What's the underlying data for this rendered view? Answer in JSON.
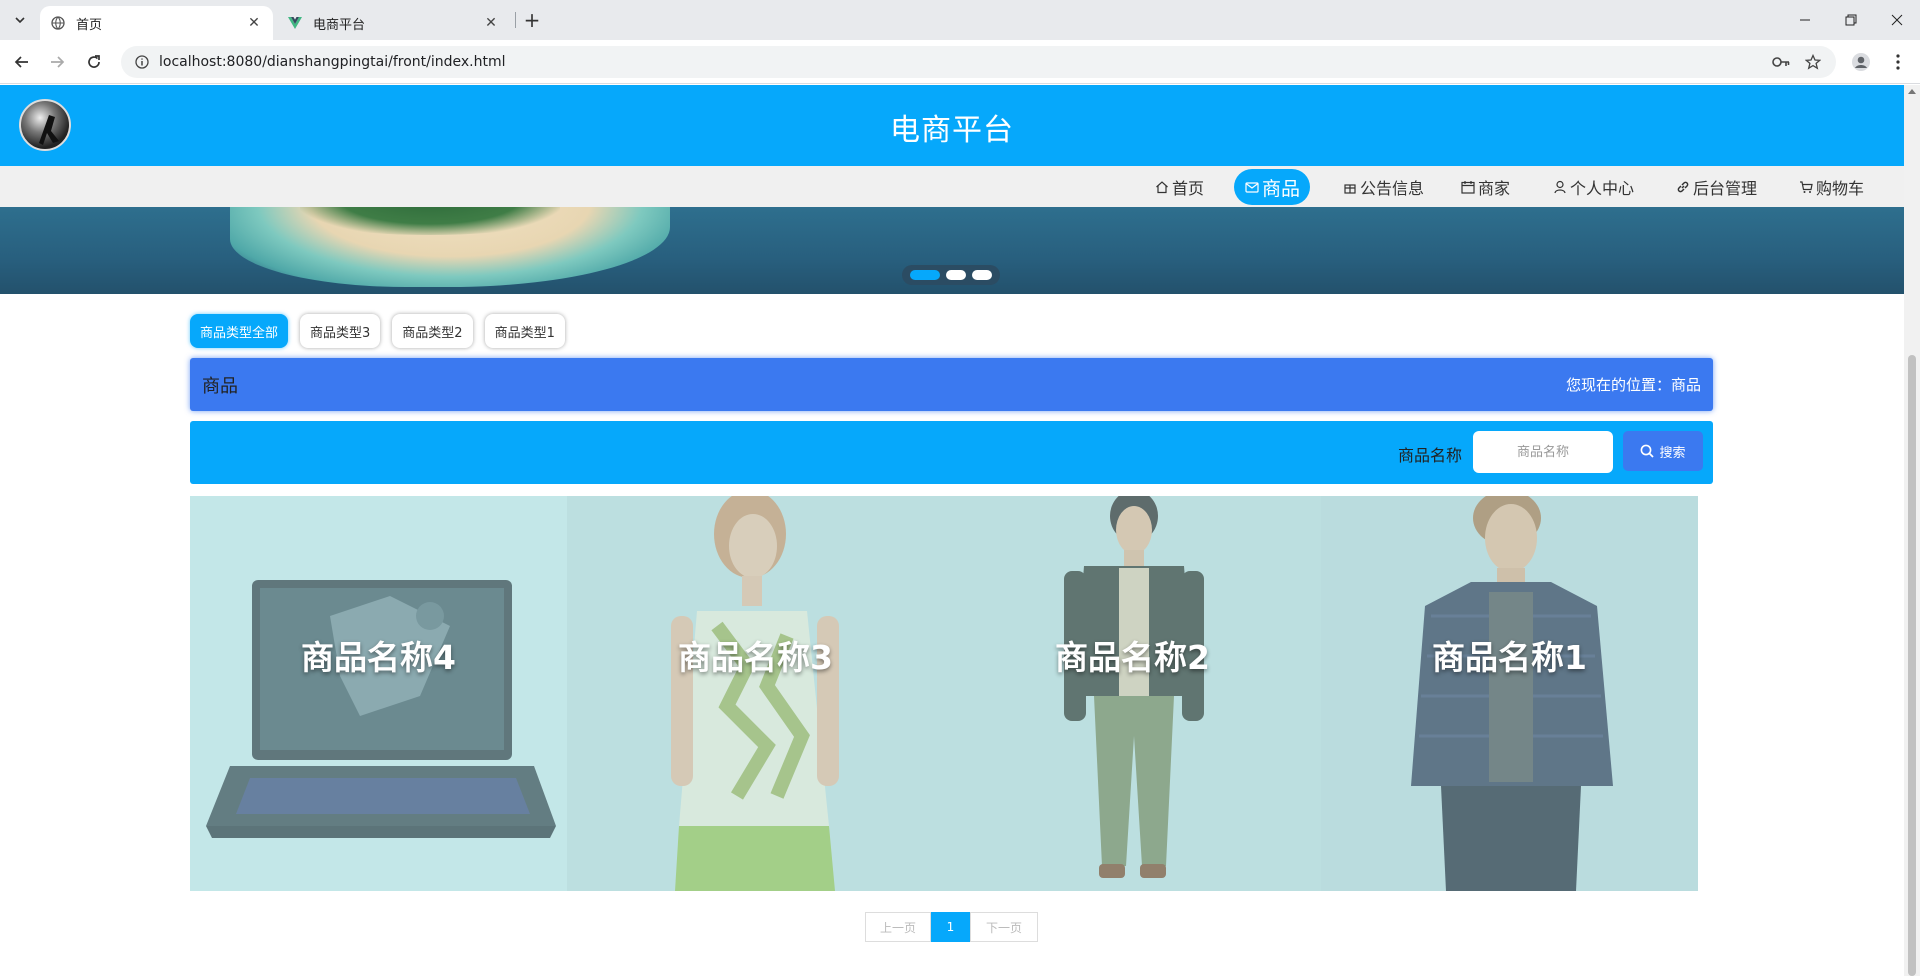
{
  "browser": {
    "tabs": [
      {
        "title": "首页",
        "active": true
      },
      {
        "title": "电商平台",
        "active": false
      }
    ],
    "url": "localhost:8080/dianshangpingtai/front/index.html"
  },
  "site": {
    "title": "电商平台",
    "nav": [
      {
        "label": "首页",
        "icon": "home-icon"
      },
      {
        "label": "商品",
        "icon": "mail-icon",
        "active": true
      },
      {
        "label": "公告信息",
        "icon": "gift-icon"
      },
      {
        "label": "商家",
        "icon": "calendar-icon"
      },
      {
        "label": "个人中心",
        "icon": "user-icon"
      },
      {
        "label": "后台管理",
        "icon": "link-icon"
      },
      {
        "label": "购物车",
        "icon": "cart-icon"
      }
    ]
  },
  "banner": {
    "slide_count": 3,
    "active_slide": 1
  },
  "filters": [
    "商品类型全部",
    "商品类型3",
    "商品类型2",
    "商品类型1"
  ],
  "crumb": {
    "title": "商品",
    "location": "您现在的位置：商品"
  },
  "search": {
    "label": "商品名称",
    "placeholder": "商品名称",
    "button": "搜索"
  },
  "products": [
    {
      "name": "商品名称4",
      "image": "laptop"
    },
    {
      "name": "商品名称3",
      "image": "woman-floral-top"
    },
    {
      "name": "商品名称2",
      "image": "man-dark-jacket"
    },
    {
      "name": "商品名称1",
      "image": "man-quilted-jacket"
    }
  ],
  "pagination": {
    "prev": "上一页",
    "current": "1",
    "next": "下一页"
  },
  "colors": {
    "primary": "#06a8fb",
    "secondary": "#3b79f0",
    "menubar": "#f0f0f0"
  }
}
